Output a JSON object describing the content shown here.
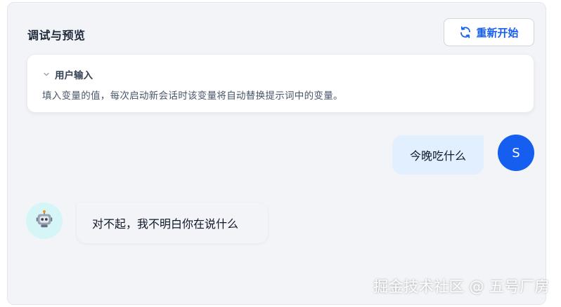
{
  "panel": {
    "title": "调试与预览",
    "restart_label": "重新开始"
  },
  "input_card": {
    "title": "用户输入",
    "description": "填入变量的值，每次启动新会话时该变量将自动替换提示词中的变量。"
  },
  "messages": {
    "user_text": "今晚吃什么",
    "user_avatar_initial": "S",
    "bot_text": "对不起，我不明白你在说什么"
  },
  "watermark": "掘金技术社区 @ 五号厂房",
  "colors": {
    "accent": "#155eef",
    "panel_bg": "#f2f4f7",
    "user_bubble": "#e1effe",
    "bot_avatar_bg": "#d5f5f6"
  },
  "icons": {
    "restart": "refresh-icon",
    "collapse": "chevron-down-icon",
    "bot": "robot-icon"
  }
}
